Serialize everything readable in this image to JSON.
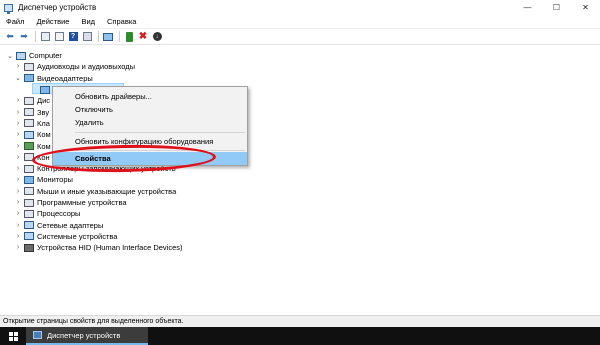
{
  "window": {
    "title": "Диспетчер устройств",
    "controls": {
      "minimize": "—",
      "maximize": "☐",
      "close": "✕"
    }
  },
  "menu": [
    "Файл",
    "Действие",
    "Вид",
    "Справка"
  ],
  "toolbar": {
    "icons": [
      "back-icon",
      "forward-icon",
      "properties-icon",
      "tree-icon",
      "help-icon",
      "view-icon",
      "monitor-icon",
      "update-driver-icon",
      "remove-icon",
      "download-icon"
    ]
  },
  "tree": {
    "root": "Computer",
    "items": [
      {
        "label": "Аудиовходы и аудиовыходы",
        "icon": "audio-icon"
      },
      {
        "label": "Видеоадаптеры",
        "icon": "display-adapter-icon",
        "expanded": true
      },
      {
        "label": "",
        "icon": "display-adapter-device-icon",
        "child": true
      },
      {
        "label": "Дис",
        "icon": "disk-icon"
      },
      {
        "label": "Зву",
        "icon": "sound-icon"
      },
      {
        "label": "Кла",
        "icon": "keyboard-icon"
      },
      {
        "label": "Ком",
        "icon": "computer-icon"
      },
      {
        "label": "Ком",
        "icon": "controller-icon"
      },
      {
        "label": "Кон",
        "icon": "ide-icon"
      },
      {
        "label": "Контроллеры запоминающих устройств",
        "icon": "storage-icon"
      },
      {
        "label": "Мониторы",
        "icon": "monitor-icon"
      },
      {
        "label": "Мыши и иные указывающие устройства",
        "icon": "mouse-icon"
      },
      {
        "label": "Программные устройства",
        "icon": "software-device-icon"
      },
      {
        "label": "Процессоры",
        "icon": "cpu-icon"
      },
      {
        "label": "Сетевые адаптеры",
        "icon": "network-icon"
      },
      {
        "label": "Системные устройства",
        "icon": "system-icon"
      },
      {
        "label": "Устройства HID (Human Interface Devices)",
        "icon": "hid-icon"
      }
    ]
  },
  "context_menu": {
    "items": [
      "Обновить драйверы...",
      "Отключить",
      "Удалить",
      "Обновить конфигурацию оборудования",
      "Свойства"
    ],
    "active_index": 4
  },
  "status": "Открытие страницы свойств для выделенного объекта.",
  "taskbar": {
    "app": "Диспетчер устройств"
  }
}
